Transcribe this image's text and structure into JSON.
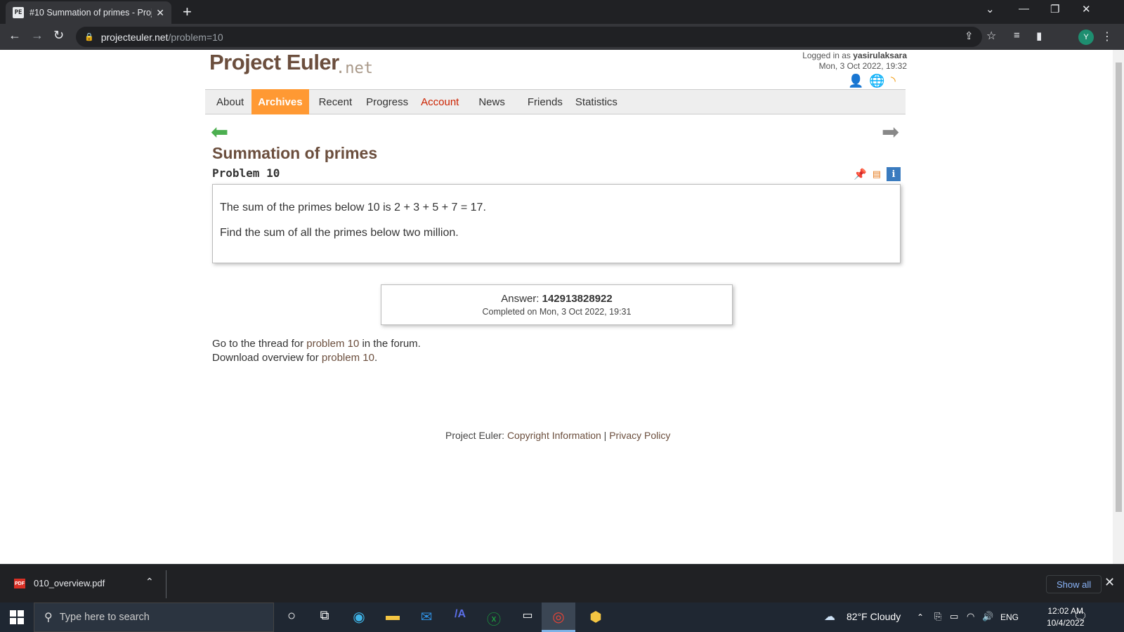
{
  "browser": {
    "tab_title": "#10 Summation of primes - Proje",
    "tab_favicon": "PE",
    "url_domain": "projecteuler.net",
    "url_path": "/problem=10",
    "profile_initial": "Y"
  },
  "site": {
    "logo_main": "Project Euler",
    "logo_suffix": ".net",
    "login_prefix": "Logged in as ",
    "username": "yasirulaksara",
    "login_datetime": "Mon, 3 Oct 2022, 19:32"
  },
  "nav": {
    "about": "About",
    "archives": "Archives",
    "recent": "Recent",
    "progress": "Progress",
    "account": "Account",
    "news": "News",
    "friends": "Friends",
    "statistics": "Statistics"
  },
  "problem": {
    "title": "Summation of primes",
    "number": "Problem 10",
    "line1": "The sum of the primes below 10 is 2 + 3 + 5 + 7 = 17.",
    "line2": "Find the sum of all the primes below two million."
  },
  "answer": {
    "label": "Answer: ",
    "value": "142913828922",
    "completed": "Completed on Mon, 3 Oct 2022, 19:31"
  },
  "links": {
    "forum_prefix": "Go to the thread for ",
    "forum_link": "problem 10",
    "forum_suffix": " in the forum.",
    "download_prefix": "Download overview for ",
    "download_link": "problem 10",
    "download_suffix": "."
  },
  "footer": {
    "prefix": "Project Euler: ",
    "copyright": "Copyright Information",
    "sep": " | ",
    "privacy": "Privacy Policy"
  },
  "downloads": {
    "file_name": "010_overview.pdf",
    "file_badge": "PDF",
    "show_all": "Show all"
  },
  "taskbar": {
    "search_placeholder": "Type here to search",
    "weather": "82°F  Cloudy",
    "language": "ENG",
    "time": "12:02 AM",
    "date": "10/4/2022"
  }
}
